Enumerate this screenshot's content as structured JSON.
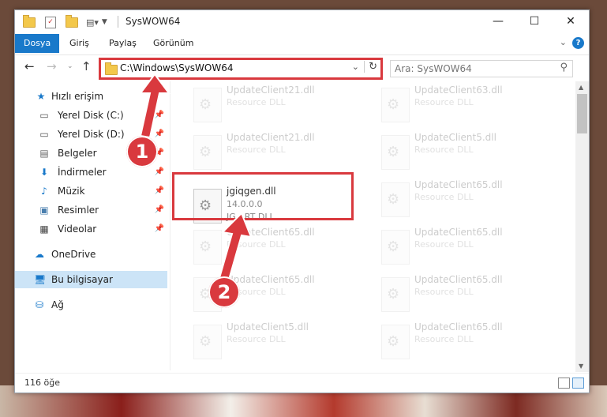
{
  "window": {
    "title": "SysWOW64"
  },
  "window_controls": {
    "minimize": "—",
    "maximize": "☐",
    "close": "✕"
  },
  "ribbon": {
    "tabs": [
      "Dosya",
      "Giriş",
      "Paylaş",
      "Görünüm"
    ],
    "help": "?"
  },
  "address": {
    "path": "C:\\Windows\\SysWOW64",
    "search_placeholder": "Ara: SysWOW64"
  },
  "nav": {
    "quick_access": "Hızlı erişim",
    "items": [
      "Yerel Disk (C:)",
      "Yerel Disk (D:)",
      "Belgeler",
      "İndirmeler",
      "Müzik",
      "Resimler",
      "Videolar"
    ],
    "onedrive": "OneDrive",
    "this_pc": "Bu bilgisayar",
    "network": "Ağ"
  },
  "files": [
    {
      "name": "UpdateClient21.dll",
      "desc": "Resource DLL"
    },
    {
      "name": "UpdateClient63.dll",
      "desc": "Resource DLL"
    },
    {
      "name": "UpdateClient21.dll",
      "desc": "Resource DLL"
    },
    {
      "name": "UpdateClient5.dll",
      "desc": "Resource DLL"
    },
    {
      "name": "jgiqgen.dll",
      "version": "14.0.0.0",
      "desc": "JG ART DLL"
    },
    {
      "name": "UpdateClient65.dll",
      "desc": "Resource DLL"
    },
    {
      "name": "UpdateClient65.dll",
      "desc": "Resource DLL"
    },
    {
      "name": "UpdateClient65.dll",
      "desc": "Resource DLL"
    },
    {
      "name": "UpdateClient65.dll",
      "desc": "Resource DLL"
    },
    {
      "name": "UpdateClient65.dll",
      "desc": "Resource DLL"
    },
    {
      "name": "UpdateClient5.dll",
      "desc": "Resource DLL"
    },
    {
      "name": "UpdateClient65.dll",
      "desc": "Resource DLL"
    }
  ],
  "status": {
    "count": "116 öğe"
  },
  "annotations": {
    "step1": "1",
    "step2": "2",
    "color": "#d9393e"
  }
}
